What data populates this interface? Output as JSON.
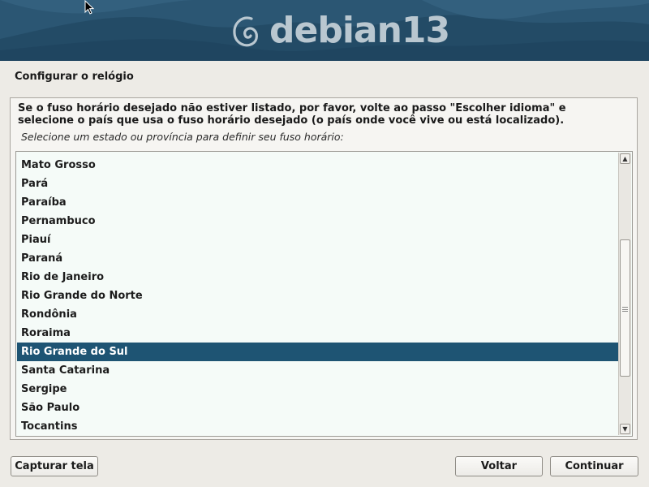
{
  "banner": {
    "logo_text": "debian13",
    "swirl_icon": "debian-swirl-icon",
    "background_color": "#2a5470"
  },
  "page_title": "Configurar o relógio",
  "description": "Se o fuso horário desejado não estiver listado, por favor, volte ao passo \"Escolher idioma\" e selecione o país que usa o fuso horário desejado (o país onde você vive ou está localizado).",
  "prompt": "Selecione um estado ou província para definir seu fuso horário:",
  "list": {
    "items": [
      "Mato Grosso",
      "Pará",
      "Paraíba",
      "Pernambuco",
      "Piauí",
      "Paraná",
      "Rio de Janeiro",
      "Rio Grande do Norte",
      "Rondônia",
      "Roraima",
      "Rio Grande do Sul",
      "Santa Catarina",
      "Sergipe",
      "São Paulo",
      "Tocantins"
    ],
    "selected": "Rio Grande do Sul",
    "selection_color": "#1e5473",
    "scroll_position": 0.62
  },
  "buttons": {
    "screenshot": "Capturar tela",
    "back": "Voltar",
    "continue": "Continuar"
  }
}
